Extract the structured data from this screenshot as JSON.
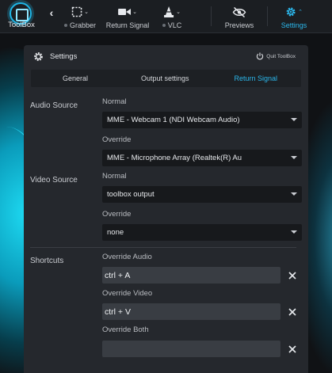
{
  "app": {
    "logo_label": "ToolBox"
  },
  "toolbar": {
    "items": [
      {
        "label": "Grabber",
        "icon": "grabber-icon"
      },
      {
        "label": "Return Signal",
        "icon": "camera-icon"
      },
      {
        "label": "VLC",
        "icon": "vlc-cone-icon"
      },
      {
        "label": "Previews",
        "icon": "eye-slash-icon"
      },
      {
        "label": "Settings",
        "icon": "gear-icon"
      }
    ]
  },
  "settings": {
    "title": "Settings",
    "quit_label": "Quit ToolBox",
    "tabs": [
      "General",
      "Output settings",
      "Return Signal"
    ],
    "active_tab": "Return Signal",
    "audio_source": {
      "section_label": "Audio Source",
      "normal_label": "Normal",
      "normal_value": "MME - Webcam 1 (NDI Webcam Audio)",
      "override_label": "Override",
      "override_value": "MME - Microphone Array (Realtek(R) Au"
    },
    "video_source": {
      "section_label": "Video Source",
      "normal_label": "Normal",
      "normal_value": "toolbox output",
      "override_label": "Override",
      "override_value": "none"
    },
    "shortcuts": {
      "section_label": "Shortcuts",
      "audio_label": "Override Audio",
      "audio_value": "ctrl + A",
      "video_label": "Override Video",
      "video_value": "ctrl + V",
      "both_label": "Override Both",
      "both_value": ""
    }
  },
  "colors": {
    "accent": "#2bb6ea",
    "panel": "#25282d",
    "toolbar": "#1b1e22"
  }
}
